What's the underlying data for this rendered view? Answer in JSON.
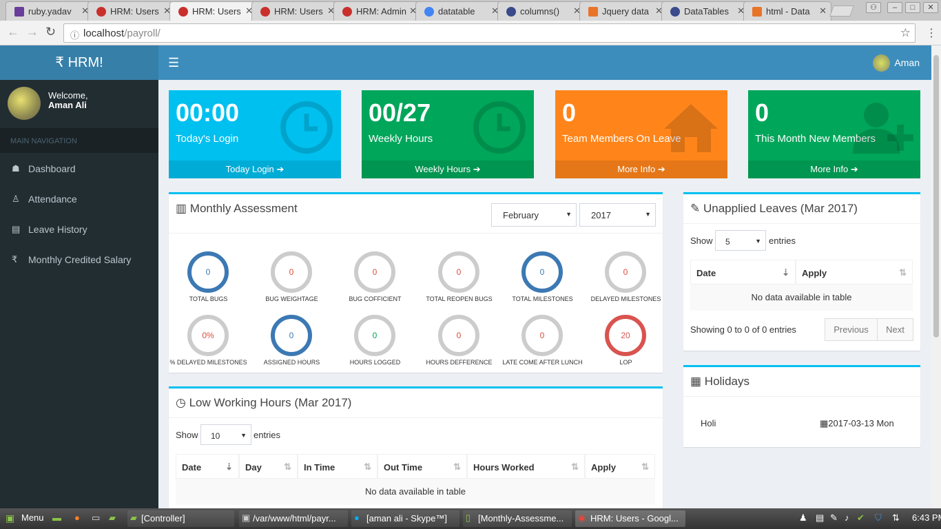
{
  "browser": {
    "tabs": [
      {
        "label": "ruby.yadav",
        "color": "#6a3d9a"
      },
      {
        "label": "HRM: Users",
        "color": "#c9302c"
      },
      {
        "label": "HRM: Users",
        "color": "#c9302c"
      },
      {
        "label": "HRM: Users",
        "color": "#c9302c"
      },
      {
        "label": "HRM: Admin",
        "color": "#c9302c"
      },
      {
        "label": "datatable",
        "color": "#4285f4"
      },
      {
        "label": "columns()",
        "color": "#3a4a8a"
      },
      {
        "label": "Jquery data",
        "color": "#e8742a"
      },
      {
        "label": "DataTables",
        "color": "#3a4a8a"
      },
      {
        "label": "html - Data",
        "color": "#e8742a"
      }
    ],
    "url_host": "localhost",
    "url_path": "/payroll/"
  },
  "header": {
    "logo": "₹ HRM!",
    "user": "Aman"
  },
  "sidebar": {
    "welcome": "Welcome,",
    "name": "Aman Ali",
    "nav_header": "MAIN NAVIGATION",
    "items": [
      {
        "label": "Dashboard",
        "icon": "dashboard-icon"
      },
      {
        "label": "Attendance",
        "icon": "person-icon"
      },
      {
        "label": "Leave History",
        "icon": "document-icon"
      },
      {
        "label": "Monthly Credited Salary",
        "icon": "rupee-icon"
      }
    ]
  },
  "stats": [
    {
      "value": "00:00",
      "label": "Today's Login",
      "footer": "Today Login",
      "color": "#00c0ef",
      "icon": "clock-icon"
    },
    {
      "value": "00/27",
      "label": "Weekly Hours",
      "footer": "Weekly Hours",
      "color": "#00a65a",
      "icon": "clock-icon"
    },
    {
      "value": "0",
      "label": "Team Members On Leave",
      "footer": "More Info",
      "color": "#ff851b",
      "icon": "home-icon"
    },
    {
      "value": "0",
      "label": "This Month New Members",
      "footer": "More Info",
      "color": "#00a65a",
      "icon": "user-plus-icon"
    }
  ],
  "assessment": {
    "title": "Monthly Assessment",
    "month": "February",
    "year": "2017",
    "metrics": [
      {
        "value": "0",
        "label": "TOTAL BUGS",
        "style": "blue"
      },
      {
        "value": "0",
        "label": "BUG WEIGHTAGE",
        "style": "grey"
      },
      {
        "value": "0",
        "label": "BUG COFFICIENT",
        "style": "grey"
      },
      {
        "value": "0",
        "label": "TOTAL REOPEN BUGS",
        "style": "grey"
      },
      {
        "value": "0",
        "label": "TOTAL MILESTONES",
        "style": "blue"
      },
      {
        "value": "0",
        "label": "DELAYED MILESTONES",
        "style": "grey"
      },
      {
        "value": "0%",
        "label": "% DELAYED MILESTONES",
        "style": "grey"
      },
      {
        "value": "0",
        "label": "ASSIGNED HOURS",
        "style": "blue"
      },
      {
        "value": "0",
        "label": "HOURS LOGGED",
        "style": "green"
      },
      {
        "value": "0",
        "label": "HOURS DEFFERENCE",
        "style": "grey"
      },
      {
        "value": "0",
        "label": "LATE COME AFTER LUNCH",
        "style": "grey"
      },
      {
        "value": "20",
        "label": "LOP",
        "style": "red"
      }
    ]
  },
  "low_hours": {
    "title": "Low Working Hours (Mar 2017)",
    "show": "Show",
    "entries_value": "10",
    "entries": "entries",
    "columns": [
      "Date",
      "Day",
      "In Time",
      "Out Time",
      "Hours Worked",
      "Apply"
    ],
    "empty": "No data available in table"
  },
  "unapplied": {
    "title": "Unapplied Leaves (Mar 2017)",
    "show": "Show",
    "entries_value": "5",
    "entries": "entries",
    "columns": [
      "Date",
      "Apply"
    ],
    "empty": "No data available in table",
    "info": "Showing 0 to 0 of 0 entries",
    "prev": "Previous",
    "next": "Next"
  },
  "holidays": {
    "title": "Holidays",
    "items": [
      {
        "name": "Holi",
        "date": "2017-03-13 Mon"
      }
    ]
  },
  "taskbar": {
    "menu": "Menu",
    "windows": [
      "[Controller]",
      "/var/www/html/payr...",
      "[aman ali - Skype™]",
      "[Monthly-Assessme...",
      "HRM: Users - Googl..."
    ],
    "time": "6:43 PM"
  }
}
